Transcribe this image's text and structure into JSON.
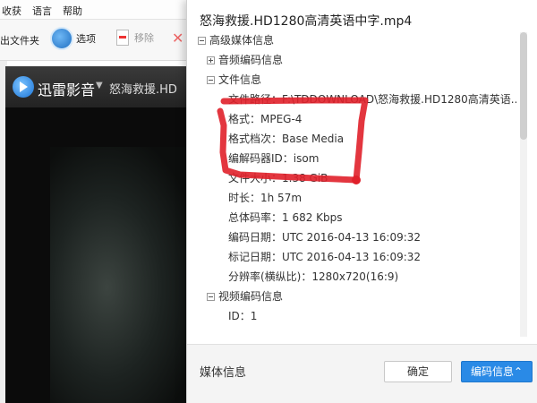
{
  "background_app": {
    "menu": [
      "收获",
      "语言",
      "帮助"
    ],
    "toolbar": {
      "export_label": "出文件夹",
      "options_label": "选项",
      "remove_label": "移除"
    },
    "player": {
      "brand": "迅雷影音",
      "title": "怒海救援.HD"
    }
  },
  "dialog": {
    "title": "怒海救援.HD1280高清英语中字.mp4",
    "tree": {
      "root_label": "高级媒体信息",
      "audio_section": "音频编码信息",
      "file_section": "文件信息",
      "file_items": [
        "文件路径：F:\\TDDOWNLOAD\\怒海救援.HD1280高清英语...",
        "格式：MPEG-4",
        "格式档次：Base Media",
        "编解码器ID：isom",
        "文件大小：1.38 GiB",
        "时长：1h 57m",
        "总体码率：1 682 Kbps",
        "编码日期：UTC 2016-04-13 16:09:32",
        "标记日期：UTC 2016-04-13 16:09:32",
        "分辨率(横纵比)：1280x720(16:9)"
      ],
      "video_section": "视频编码信息",
      "video_items": [
        "ID：1"
      ]
    },
    "footer": {
      "label": "媒体信息",
      "ok_button": "确定",
      "codec_button": "编码信息⌃"
    }
  },
  "colors": {
    "accent_blue": "#2a8ae6",
    "annotation_red": "#e0202a"
  }
}
